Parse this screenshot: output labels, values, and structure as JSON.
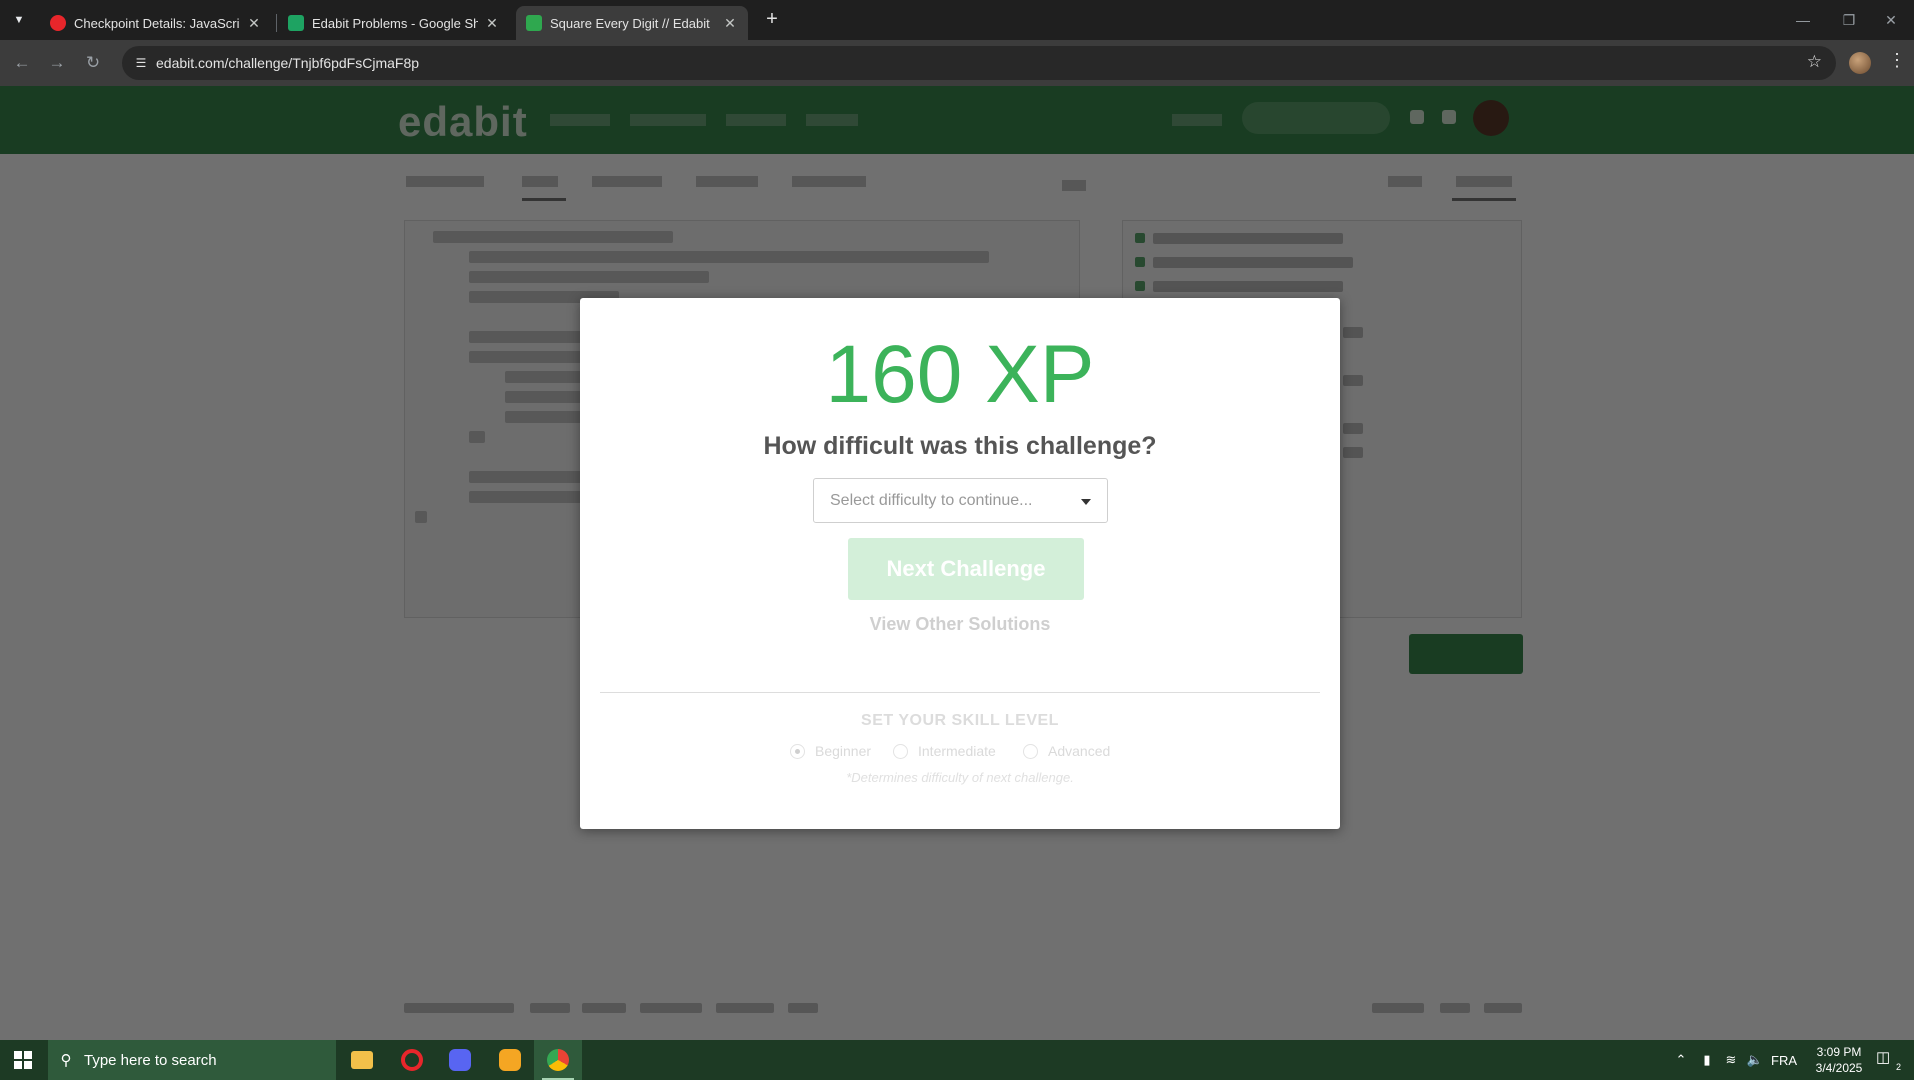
{
  "browser": {
    "tabs": [
      {
        "title": "Checkpoint Details: JavaScript F",
        "favicon": "opera-icon",
        "color": "#e8262b",
        "active": false
      },
      {
        "title": "Edabit Problems - Google Shee",
        "favicon": "google-sheets-icon",
        "color": "#1ea362",
        "active": false
      },
      {
        "title": "Square Every Digit // Edabit",
        "favicon": "edabit-icon",
        "color": "#2fa84f",
        "active": true
      }
    ],
    "url": "edabit.com/challenge/Tnjbf6pdFsCjmaF8p"
  },
  "modal": {
    "xp_text": "160 XP",
    "question": "How difficult was this challenge?",
    "select_placeholder": "Select difficulty to continue...",
    "next_button": "Next Challenge",
    "other_solutions_link": "View Other Solutions",
    "skill_title": "SET YOUR SKILL LEVEL",
    "skill_options": [
      {
        "label": "Beginner",
        "selected": true
      },
      {
        "label": "Intermediate",
        "selected": false
      },
      {
        "label": "Advanced",
        "selected": false
      }
    ],
    "skill_note": "*Determines difficulty of next challenge."
  },
  "taskbar": {
    "search_placeholder": "Type here to search",
    "apps": [
      "file-explorer-icon",
      "opera-icon",
      "discord-icon",
      "brave-icon",
      "chrome-icon"
    ],
    "language": "FRA",
    "time": "3:09 PM",
    "date": "3/4/2025",
    "notification_count": "2"
  },
  "colors": {
    "xp_green": "#3cb35a",
    "header_green": "#3a8a4f",
    "taskbar": "#1d3a24"
  }
}
